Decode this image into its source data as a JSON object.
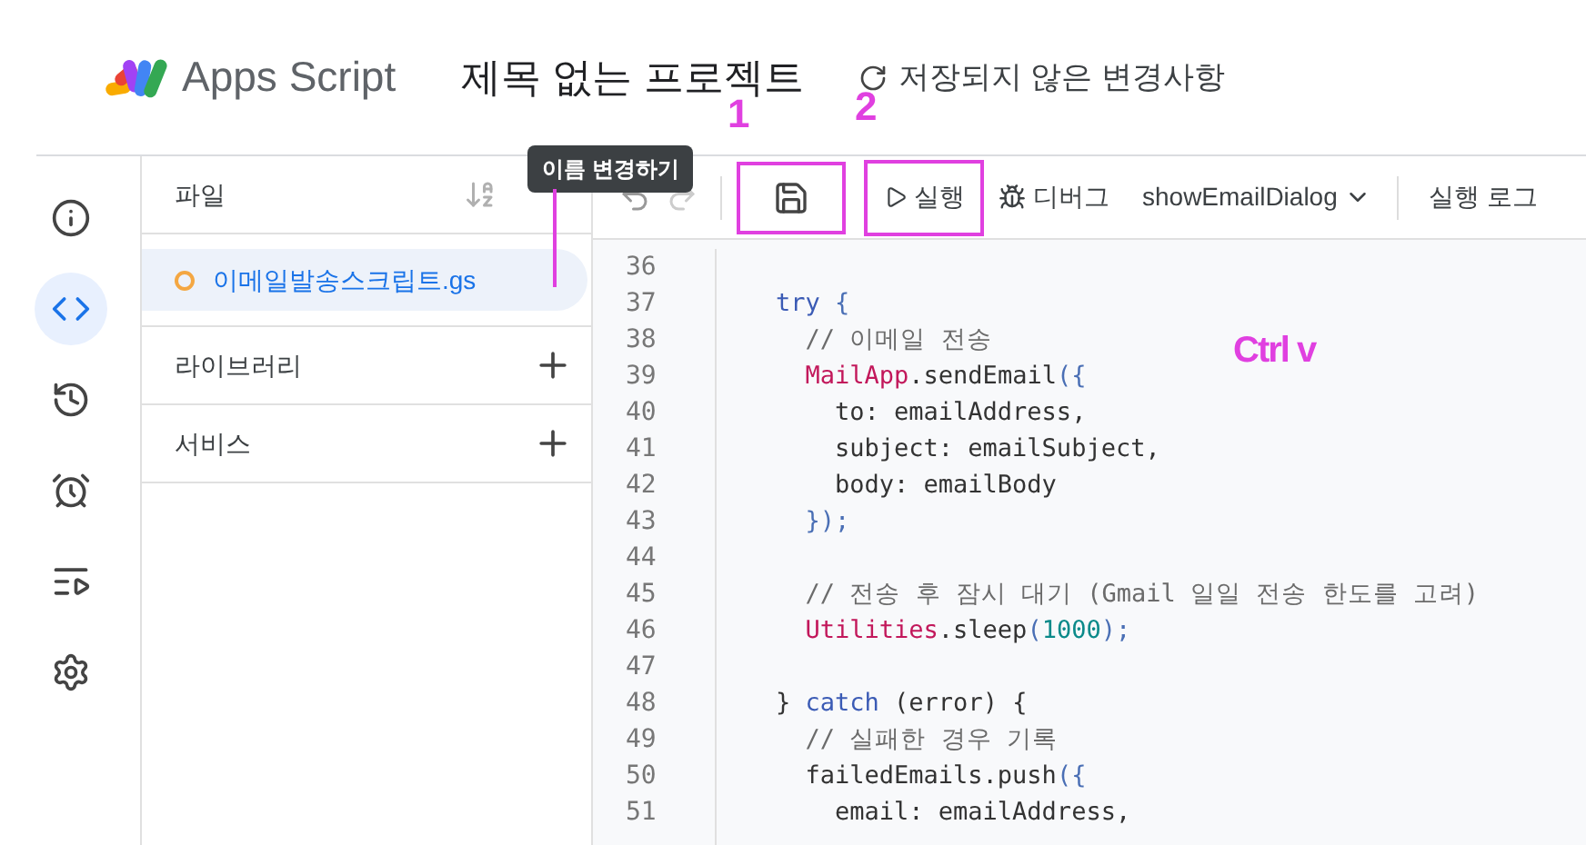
{
  "header": {
    "product": "Apps Script",
    "project_title": "제목 없는 프로젝트",
    "status": "저장되지 않은 변경사항"
  },
  "rail": [
    {
      "kind": "info",
      "selected": false
    },
    {
      "kind": "code",
      "selected": true
    },
    {
      "kind": "history",
      "selected": false
    },
    {
      "kind": "triggers",
      "selected": false
    },
    {
      "kind": "executions",
      "selected": false
    },
    {
      "kind": "settings",
      "selected": false
    }
  ],
  "files_panel": {
    "title": "파일",
    "files": [
      {
        "name": "이메일발송스크립트.gs",
        "selected": true
      }
    ],
    "sections": [
      "라이브러리",
      "서비스"
    ]
  },
  "tooltip": "이름 변경하기",
  "toolbar": {
    "save_highlighted": true,
    "run": "실행",
    "run_highlighted": true,
    "debug": "디버그",
    "function": "showEmailDialog",
    "log": "실행 로그"
  },
  "code": [
    {
      "number": "36"
    },
    {
      "number": "37",
      "tokens": [
        {
          "text": "    try",
          "kind": "keyword"
        },
        {
          "text": " {",
          "kind": "punctuation"
        }
      ]
    },
    {
      "number": "38",
      "tokens": [
        {
          "text": "      // 이메일 전송",
          "kind": "comment"
        }
      ]
    },
    {
      "number": "39",
      "tokens": [
        {
          "text": "      MailApp",
          "kind": "class"
        },
        {
          "text": ".sendEmail",
          "kind": "plain"
        },
        {
          "text": "({",
          "kind": "punctuation"
        }
      ]
    },
    {
      "number": "40",
      "tokens": [
        {
          "text": "        to: emailAddress,",
          "kind": "plain"
        }
      ]
    },
    {
      "number": "41",
      "tokens": [
        {
          "text": "        subject: emailSubject,",
          "kind": "plain"
        }
      ]
    },
    {
      "number": "42",
      "tokens": [
        {
          "text": "        body: emailBody",
          "kind": "plain"
        }
      ]
    },
    {
      "number": "43",
      "tokens": [
        {
          "text": "      });",
          "kind": "punctuation"
        }
      ]
    },
    {
      "number": "44"
    },
    {
      "number": "45",
      "tokens": [
        {
          "text": "      // 전송 후 잠시 대기 (Gmail 일일 전송 한도를 고려)",
          "kind": "comment"
        }
      ]
    },
    {
      "number": "46",
      "tokens": [
        {
          "text": "      Utilities",
          "kind": "class"
        },
        {
          "text": ".sleep",
          "kind": "plain"
        },
        {
          "text": "(",
          "kind": "punctuation"
        },
        {
          "text": "1000",
          "kind": "number"
        },
        {
          "text": ");",
          "kind": "punctuation"
        }
      ]
    },
    {
      "number": "47"
    },
    {
      "number": "48",
      "tokens": [
        {
          "text": "    } ",
          "kind": "plain"
        },
        {
          "text": "catch",
          "kind": "keyword"
        },
        {
          "text": " (error) {",
          "kind": "plain"
        }
      ]
    },
    {
      "number": "49",
      "tokens": [
        {
          "text": "      // 실패한 경우 기록",
          "kind": "comment"
        }
      ]
    },
    {
      "number": "50",
      "tokens": [
        {
          "text": "      failedEmails.push",
          "kind": "plain"
        },
        {
          "text": "({",
          "kind": "punctuation"
        }
      ]
    },
    {
      "number": "51",
      "tokens": [
        {
          "text": "        email: emailAddress,",
          "kind": "plain"
        }
      ]
    }
  ],
  "annotations": [
    {
      "kind": "number",
      "text": "1"
    },
    {
      "kind": "number",
      "text": "2"
    },
    {
      "kind": "note",
      "text": "Ctrl v"
    },
    {
      "kind": "line"
    }
  ]
}
